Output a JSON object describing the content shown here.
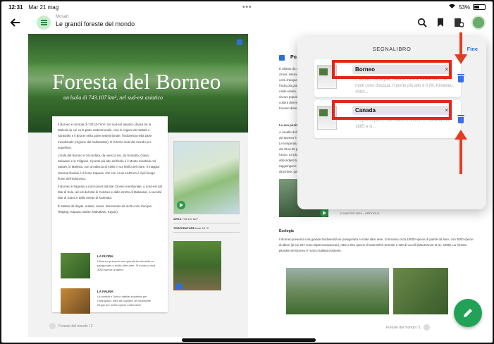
{
  "status": {
    "time": "12:31",
    "date": "Mar 21 mag",
    "battery": "53%",
    "battery_level": 0.53
  },
  "header": {
    "publisher": "Mosart",
    "book_title": "Le grandi foreste del mondo"
  },
  "page_left": {
    "title": "Foresta del Borneo",
    "subtitle": "un'isola di 743.107 km², nel sud-est asiatico",
    "paragraphs": [
      "Il Borneo è un'isola di 743.107 km², nel sud-est asiatico, divisa tra la Malesia (a cui va la parte settentrionale, cioè le regioni del Sabah e Sarawak) e il Brunei nella parte settentrionale, l'Indonesia nella parte meridionale (regione del Kalimantan). È la terza isola del mondo per superficie.",
      "L'isola del Borneo è circondata, da ovest a est, da Sumatra, Giava, Sulawesi e le Filippine. Il punto più alto dell'isola è il Monte Kinabalu nel Sabah, in Malesia, con un'altezza di 4095 m sul livello del mare. Il maggior sistema fluviale è il fiume Kapuas, che con i suoi 1143 km è il più lungo fiume dell'Indonesia.",
      "Il Borneo è bagnato a nord-ovest dal Mar Cinese meridionale, a nord-est dal Mar di Sulu, ad est dal Mar di Celebes e dallo stretto di Makassar, a sud dal Mar di Giava e dallo stretto di Karimata.",
      "È abitato da dayak, malesi, cinesi; Interessato da molti corsi d'acqua (Rajang, Kapuas, Barito, Mahakam, Kayan)."
    ],
    "sidebar": [
      {
        "title": "LA FLORA",
        "text": "Il Borneo presenta una grande biodiversità se paragonata a molte altre aree. Si trovano circa 3000 specie di alberi."
      },
      {
        "title": "LA FAUNA",
        "text": "La foresta è l'unico habitat esistente per l'orangutan, oltre ad ospitare un importante rifugio per molte specie endemiche."
      }
    ],
    "map_labels": {
      "area": "AREA",
      "area_value": "743.107 km²",
      "temp": "TEMPERATURE",
      "temp_value": "from 18 °C"
    },
    "footer": "Foreste del mondo / 2"
  },
  "page_right": {
    "heading": "Po...",
    "paragraph": "È abitato da dayak, malesi, cinesi; interessato da molti corsi d'acqua. Il Borneo è l'isola più grande dell'Asia e caldo-umido. Nel Borneo vivono popolazioni di lingua e cultura diverse, dove si trovano diamanti.",
    "subhead": "La sua posizione",
    "para2": "A cavallo dell'equatore, il clima del Borneo è tropicale umido. Le temperature medie variano dai 25 ai 35 gradi durante l'anno. Le piogge sono abbondanti tutto l'anno e raggiungono il picco tra dicembre, gennaio e febbraio.",
    "article_date": "11 MAGGIO 2016 – ARTICOLO",
    "ecology_title": "Ecologia",
    "ecology_text": "Il Borneo presenta una grande biodiversità se paragonata a molte altre aree. Si trovano circa 15000 specie di piante da fiore, con 3000 specie di alberi (di cui 267 sono Dipterocarpaceae), oltre a 221 specie di mammiferi terrestri e 420 di uccelli (MacKinnon et al., 1998). La foresta pluviale del Borneo è l'unico habitat esistente.",
    "footer": "Foreste del mondo / 1"
  },
  "bookmarks_panel": {
    "title": "SEGNALIBRO",
    "done_label": "Fine",
    "items": [
      {
        "name": "Borneo",
        "snippet": "È abitato da dayak, malesi, cinesi, interessato da molti corsi d'acqua. Il punto più alto è il (M. Kinabalu, 4094..."
      },
      {
        "name": "Canada",
        "snippet": "È il primo parco nazionale costituito in Canada nel 1885 e si..."
      }
    ]
  },
  "colors": {
    "accent": "#2f6fd8",
    "fab": "#22a257",
    "highlight": "#e3261a",
    "trash": "#3b6ee8"
  }
}
